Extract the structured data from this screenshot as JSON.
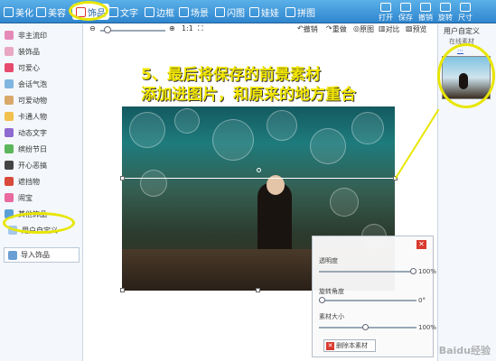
{
  "toolbar": {
    "tabs": [
      {
        "label": "美化"
      },
      {
        "label": "美容"
      },
      {
        "label": "饰品"
      },
      {
        "label": "文字"
      },
      {
        "label": "边框"
      },
      {
        "label": "场景"
      },
      {
        "label": "闪图"
      },
      {
        "label": "娃娃"
      },
      {
        "label": "拼图"
      }
    ],
    "right": [
      {
        "label": "打开"
      },
      {
        "label": "保存"
      },
      {
        "label": "撤销"
      },
      {
        "label": "旋转"
      },
      {
        "label": "尺寸"
      }
    ]
  },
  "sidebar": {
    "items": [
      {
        "label": "非主流印"
      },
      {
        "label": "装饰品"
      },
      {
        "label": "可爱心"
      },
      {
        "label": "会话气泡"
      },
      {
        "label": "可爱动物"
      },
      {
        "label": "卡通人物"
      },
      {
        "label": "动态文字"
      },
      {
        "label": "缤纷节日"
      },
      {
        "label": "开心恶搞"
      },
      {
        "label": "遮挡物"
      },
      {
        "label": "闹宝"
      },
      {
        "label": "其他饰品"
      },
      {
        "label": "用户自定义"
      }
    ],
    "import_label": "导入饰品"
  },
  "canvas_toolbar": {
    "zoom_label": "1:1",
    "undo": "撤销",
    "redo": "重做",
    "original": "原图",
    "compare": "对比",
    "preview": "预览"
  },
  "instruction": {
    "line1": "5、最后将保存的前景素材",
    "line2": "添加进图片，和原来的地方重合"
  },
  "panel": {
    "transparency_label": "透明度",
    "transparency_value": "100%",
    "rotate_label": "旋转角度",
    "rotate_value": "0°",
    "size_label": "素材大小",
    "size_value": "100%",
    "delete_label": "删除本素材"
  },
  "right_panel": {
    "title": "用户自定义",
    "subtitle": "在线素材"
  },
  "watermark": "Baidu经验"
}
